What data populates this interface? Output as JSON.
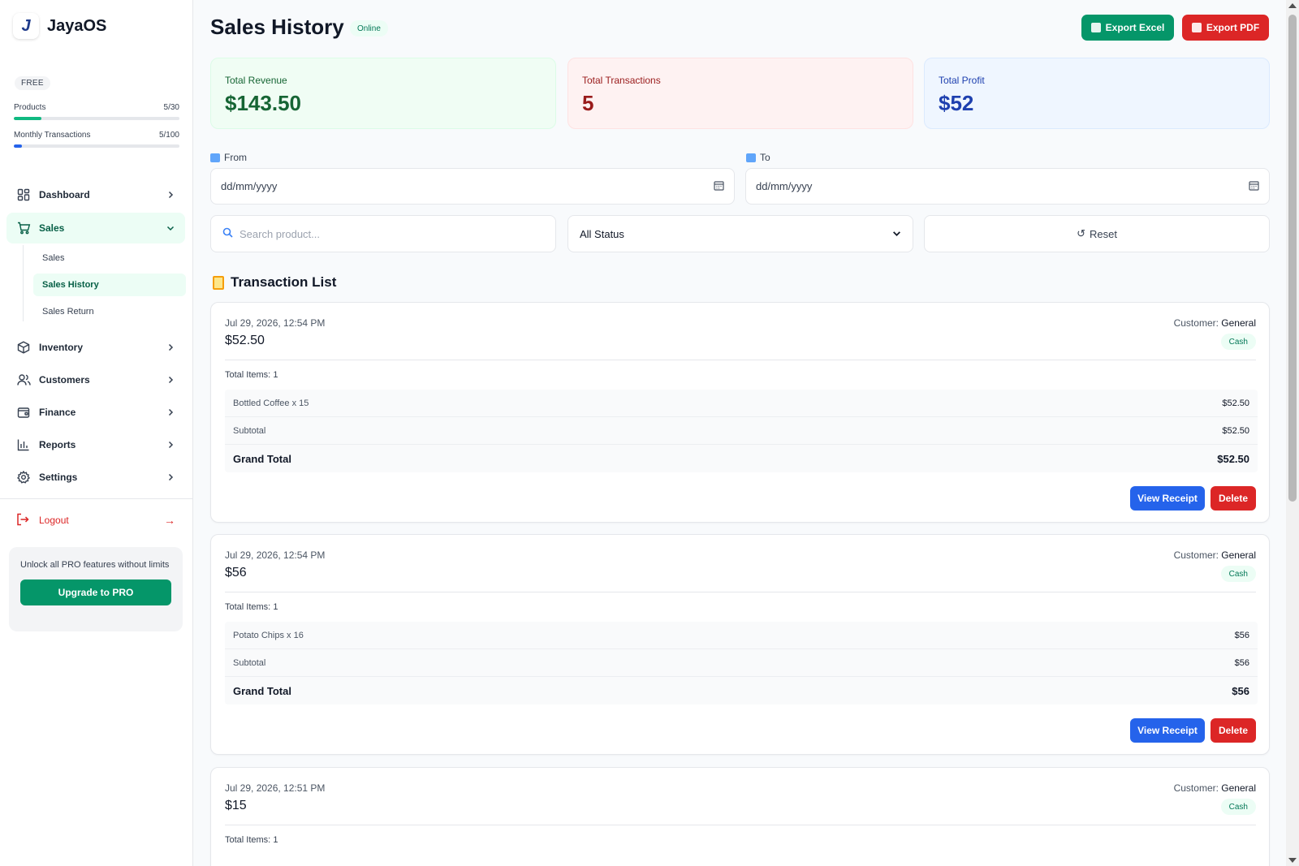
{
  "app": {
    "name": "JayaOS"
  },
  "plan": {
    "badge": "FREE",
    "products": {
      "label": "Products",
      "value": "5/30",
      "fraction": 0.167
    },
    "transactions": {
      "label": "Monthly Transactions",
      "value": "5/100",
      "fraction": 0.05
    }
  },
  "nav": {
    "dashboard": "Dashboard",
    "sales": "Sales",
    "sales_sub": [
      "Sales",
      "Sales History",
      "Sales Return"
    ],
    "inventory": "Inventory",
    "customers": "Customers",
    "finance": "Finance",
    "reports": "Reports",
    "settings": "Settings",
    "logout": "Logout",
    "logout_arrow": "→"
  },
  "promo": {
    "text": "Unlock all PRO features without limits",
    "button": "Upgrade to PRO"
  },
  "header": {
    "title": "Sales History",
    "status": "Online",
    "export_excel": "Export Excel",
    "export_pdf": "Export PDF"
  },
  "stats": {
    "revenue": {
      "label": "Total Revenue",
      "value": "$143.50"
    },
    "transactions": {
      "label": "Total Transactions",
      "value": "5"
    },
    "profit": {
      "label": "Total Profit",
      "value": "$52"
    }
  },
  "filters": {
    "from_label": "From",
    "to_label": "To",
    "from_placeholder": "dd/mm/yyyy",
    "to_placeholder": "dd/mm/yyyy",
    "search_placeholder": "Search product...",
    "status_selected": "All Status",
    "reset": "Reset",
    "reset_icon": "↺"
  },
  "list": {
    "title": "Transaction List",
    "customer_prefix": "Customer:",
    "items_label": "Total Items:",
    "subtotal_label": "Subtotal",
    "grand_total_label": "Grand Total",
    "view_receipt": "View Receipt",
    "delete": "Delete"
  },
  "transactions": [
    {
      "date": "Jul 29, 2026, 12:54 PM",
      "amount": "$52.50",
      "customer": "General",
      "payment": "Cash",
      "total_items": "1",
      "item_name": "Bottled Coffee",
      "item_qty": "x 15",
      "item_price": "$52.50",
      "subtotal": "$52.50",
      "grand_total": "$52.50"
    },
    {
      "date": "Jul 29, 2026, 12:54 PM",
      "amount": "$56",
      "customer": "General",
      "payment": "Cash",
      "total_items": "1",
      "item_name": "Potato Chips",
      "item_qty": "x 16",
      "item_price": "$56",
      "subtotal": "$56",
      "grand_total": "$56"
    },
    {
      "date": "Jul 29, 2026, 12:51 PM",
      "amount": "$15",
      "customer": "General",
      "payment": "Cash",
      "total_items": "1"
    }
  ],
  "colors": {
    "brand_green": "#059669",
    "danger": "#dc2626",
    "primary_blue": "#2563eb",
    "revenue_text": "#166534",
    "transactions_text": "#991b1b",
    "profit_text": "#1e40af"
  }
}
